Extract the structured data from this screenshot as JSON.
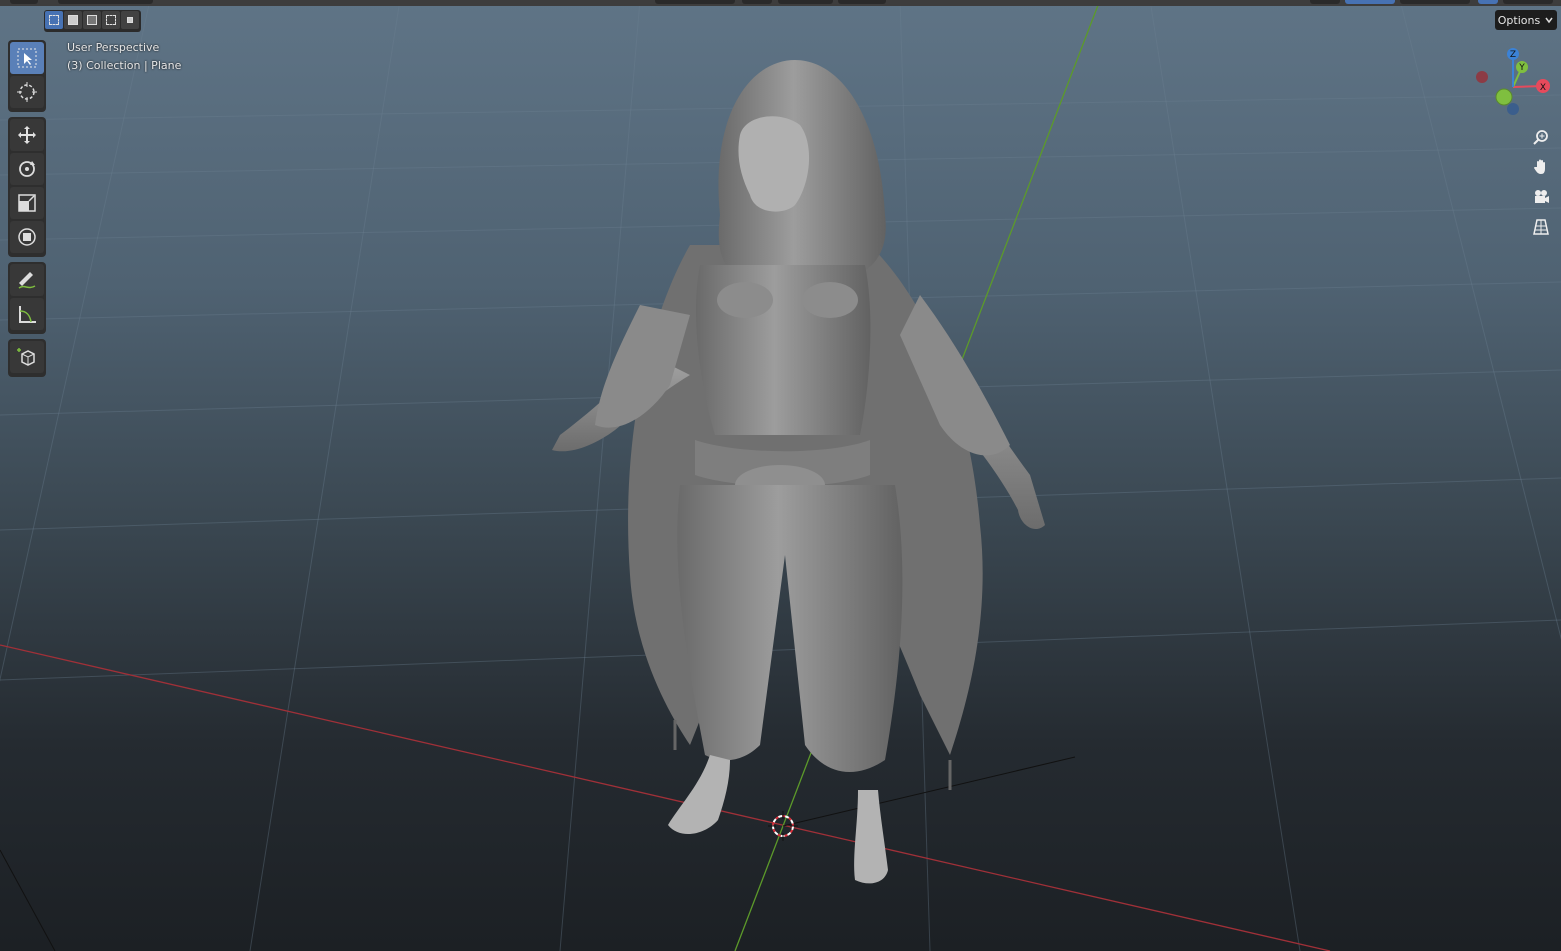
{
  "viewport": {
    "view_name": "User Perspective",
    "collection_line": "(3) Collection | Plane",
    "options_label": "Options",
    "options_chevron": "chevron-down-icon"
  },
  "header": {
    "select_modes": [
      "select-box-icon",
      "select-extend-icon",
      "select-subtract-icon",
      "select-invert-icon",
      "select-intersect-icon"
    ]
  },
  "toolbar": {
    "tools": [
      {
        "name": "select-box",
        "icon": "cursor-icon",
        "active": true
      },
      {
        "name": "cursor",
        "icon": "3d-cursor-icon"
      },
      {
        "name": "move",
        "icon": "move-icon"
      },
      {
        "name": "rotate",
        "icon": "rotate-icon"
      },
      {
        "name": "scale",
        "icon": "scale-icon"
      },
      {
        "name": "transform",
        "icon": "transform-icon"
      },
      {
        "name": "annotate",
        "icon": "annotate-icon"
      },
      {
        "name": "measure",
        "icon": "measure-icon"
      },
      {
        "name": "add-cube",
        "icon": "add-cube-icon"
      }
    ]
  },
  "gizmo": {
    "x_label": "X",
    "y_label": "Y",
    "z_label": "Z",
    "x_color": "#e64a5c",
    "y_color": "#7fbf3f",
    "z_color": "#3b82d6"
  },
  "nav_buttons": [
    "zoom-icon",
    "hand-pan-icon",
    "camera-icon",
    "grid-ortho-icon"
  ],
  "colors": {
    "accent": "#4772b3",
    "x_axis_line": "#a03038",
    "y_axis_line": "#5c9a2a"
  }
}
